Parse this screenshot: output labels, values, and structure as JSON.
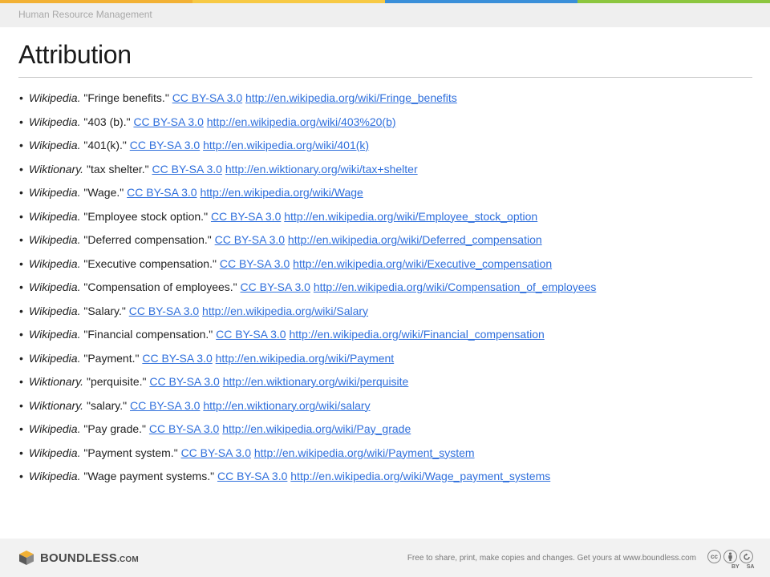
{
  "colors": {
    "topbar": [
      "#f2b134",
      "#f7c944",
      "#3a8fd9",
      "#8cc63f"
    ],
    "link": "#2f6fdc"
  },
  "header": {
    "course_title": "Human Resource Management"
  },
  "slide": {
    "title": "Attribution"
  },
  "attributions": [
    {
      "source": "Wikipedia.",
      "title": "\"Fringe benefits.\"",
      "license": "CC BY-SA 3.0",
      "url": "http://en.wikipedia.org/wiki/Fringe_benefits"
    },
    {
      "source": "Wikipedia.",
      "title": "\"403 (b).\"",
      "license": "CC BY-SA 3.0",
      "url": "http://en.wikipedia.org/wiki/403%20(b)"
    },
    {
      "source": "Wikipedia.",
      "title": "\"401(k).\"",
      "license": "CC BY-SA 3.0",
      "url": "http://en.wikipedia.org/wiki/401(k)"
    },
    {
      "source": "Wiktionary.",
      "title": "\"tax shelter.\"",
      "license": "CC BY-SA 3.0",
      "url": "http://en.wiktionary.org/wiki/tax+shelter"
    },
    {
      "source": "Wikipedia.",
      "title": "\"Wage.\"",
      "license": "CC BY-SA 3.0",
      "url": "http://en.wikipedia.org/wiki/Wage"
    },
    {
      "source": "Wikipedia.",
      "title": "\"Employee stock option.\"",
      "license": "CC BY-SA 3.0",
      "url": "http://en.wikipedia.org/wiki/Employee_stock_option"
    },
    {
      "source": "Wikipedia.",
      "title": "\"Deferred compensation.\"",
      "license": "CC BY-SA 3.0",
      "url": "http://en.wikipedia.org/wiki/Deferred_compensation"
    },
    {
      "source": "Wikipedia.",
      "title": "\"Executive compensation.\"",
      "license": "CC BY-SA 3.0",
      "url": "http://en.wikipedia.org/wiki/Executive_compensation"
    },
    {
      "source": "Wikipedia.",
      "title": "\"Compensation of employees.\"",
      "license": "CC BY-SA 3.0",
      "url": "http://en.wikipedia.org/wiki/Compensation_of_employees"
    },
    {
      "source": "Wikipedia.",
      "title": "\"Salary.\"",
      "license": "CC BY-SA 3.0",
      "url": "http://en.wikipedia.org/wiki/Salary"
    },
    {
      "source": "Wikipedia.",
      "title": "\"Financial compensation.\"",
      "license": "CC BY-SA 3.0",
      "url": "http://en.wikipedia.org/wiki/Financial_compensation"
    },
    {
      "source": "Wikipedia.",
      "title": "\"Payment.\"",
      "license": "CC BY-SA 3.0",
      "url": "http://en.wikipedia.org/wiki/Payment"
    },
    {
      "source": "Wiktionary.",
      "title": "\"perquisite.\"",
      "license": "CC BY-SA 3.0",
      "url": "http://en.wiktionary.org/wiki/perquisite"
    },
    {
      "source": "Wiktionary.",
      "title": "\"salary.\"",
      "license": "CC BY-SA 3.0",
      "url": "http://en.wiktionary.org/wiki/salary"
    },
    {
      "source": "Wikipedia.",
      "title": "\"Pay grade.\"",
      "license": "CC BY-SA 3.0",
      "url": "http://en.wikipedia.org/wiki/Pay_grade"
    },
    {
      "source": "Wikipedia.",
      "title": "\"Payment system.\"",
      "license": "CC BY-SA 3.0",
      "url": "http://en.wikipedia.org/wiki/Payment_system"
    },
    {
      "source": "Wikipedia.",
      "title": "\"Wage payment systems.\"",
      "license": "CC BY-SA 3.0",
      "url": "http://en.wikipedia.org/wiki/Wage_payment_systems"
    }
  ],
  "footer": {
    "logo_text": "BOUNDLESS",
    "logo_suffix": ".COM",
    "note": "Free to share, print, make copies and changes. Get yours at www.boundless.com",
    "cc_labels": [
      "BY",
      "SA"
    ],
    "cc_icon_names": [
      "cc-icon",
      "by-icon",
      "sa-icon"
    ]
  }
}
